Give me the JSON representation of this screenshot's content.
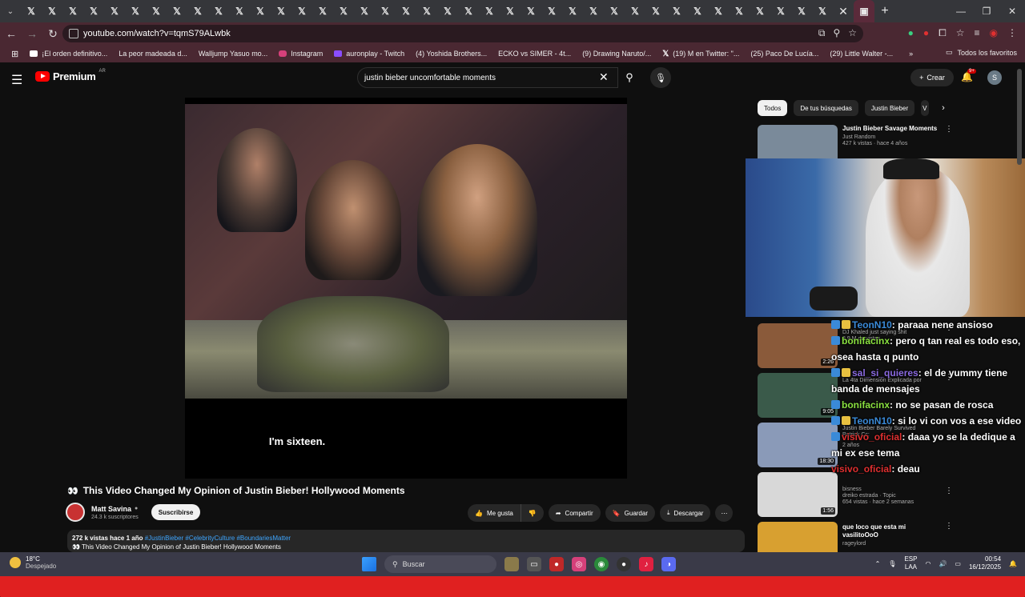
{
  "browser": {
    "url": "youtube.com/watch?v=tqmS79ALwbk",
    "bookmarks": [
      {
        "label": "¡El orden definitivo...",
        "icon": "el"
      },
      {
        "label": "La peor madeada d...",
        "icon": "yt"
      },
      {
        "label": "Walljump Yasuo mo...",
        "icon": "yt"
      },
      {
        "label": "Instagram",
        "icon": "ig"
      },
      {
        "label": "auronplay - Twitch",
        "icon": "tw"
      },
      {
        "label": "(4) Yoshida Brothers...",
        "icon": "yt"
      },
      {
        "label": "ECKO vs SIMER - 4t...",
        "icon": "yt"
      },
      {
        "label": "(9) Drawing Naruto/...",
        "icon": "yt"
      },
      {
        "label": "(19) M en Twitter: \"...",
        "icon": "x"
      },
      {
        "label": "(25) Paco De Lucía...",
        "icon": "yt"
      },
      {
        "label": "(29) Little Walter -...",
        "icon": "yt"
      }
    ],
    "bookmarks_folder": "Todos los favoritos"
  },
  "youtube": {
    "logo_text": "Premium",
    "region": "AR",
    "search_query": "justin bieber uncomfortable moments",
    "create_label": "Crear",
    "notif_count": "9+",
    "avatar_letter": "S",
    "video": {
      "subtitle": "I'm sixteen.",
      "title": "This Video Changed My Opinion of Justin Bieber! Hollywood Moments",
      "title_emoji": "👀",
      "channel": "Matt Savina",
      "subscribers": "24.3 k suscriptores",
      "subscribe_label": "Suscribirse",
      "like_label": "Me gusta",
      "share_label": "Compartir",
      "save_label": "Guardar",
      "download_label": "Descargar",
      "stats": "272 k vistas  hace 1 año",
      "tags": "#JustinBieber #CelebrityCulture #BoundariesMatter",
      "desc_line2": "👀 This Video Changed My Opinion of Justin Bieber! Hollywood Moments"
    },
    "chips": [
      {
        "label": "Todos",
        "active": true
      },
      {
        "label": "De tus búsquedas",
        "active": false
      },
      {
        "label": "Justin Bieber",
        "active": false
      },
      {
        "label": "V",
        "active": false
      }
    ],
    "recommendations": [
      {
        "title": "Justin Bieber Savage Moments",
        "channel": "Just Random",
        "views": "427 k vistas · hace 4 años",
        "duration": "",
        "thumb_color": "#7a8a9a"
      },
      {
        "title": "DJ Khaled just saying shit",
        "channel": "",
        "views": "3.9 M de vistas",
        "duration": "2:26",
        "thumb_color": "#8a5a3a"
      },
      {
        "title": "La 4ta Dimensión Explicada por",
        "channel": "",
        "views": "",
        "duration": "9:05",
        "thumb_color": "#3a5a4a"
      },
      {
        "title": "Justin Bieber Barely Survived",
        "channel": "Patrick Cc:",
        "views": "2 años",
        "duration": "18:30",
        "thumb_color": "#8a9ab8"
      },
      {
        "title": "bisness",
        "channel": "dreiko estrada · Topic",
        "views": "654 vistas · hace 2 semanas",
        "duration": "1:56",
        "thumb_color": "#d8d8d8"
      },
      {
        "title": "que loco que esta mi vasilitoOoO",
        "channel": "rageylord",
        "views": "",
        "duration": "",
        "thumb_color": "#d8a030"
      }
    ]
  },
  "stream_chat": [
    {
      "user": "TeonN10",
      "user_color": "#3a8ad8",
      "text": ": paraaa nene ansioso"
    },
    {
      "user": "bonifacinx",
      "user_color": "#8ae040",
      "text": ": pero q tan real es todo eso, osea hasta q punto"
    },
    {
      "user": "sal_si_quieres",
      "user_color": "#8a6ae0",
      "text": ": el de yummy tiene banda de mensajes"
    },
    {
      "user": "bonifacinx",
      "user_color": "#8ae040",
      "text": ": no se pasan de rosca"
    },
    {
      "user": "TeonN10",
      "user_color": "#3a8ad8",
      "text": ": si lo vi con vos a ese video"
    },
    {
      "user": "visivo_oficial",
      "user_color": "#e03030",
      "text": ": daaa yo se la dedique a mi ex ese tema"
    },
    {
      "user": "visivo_oficial",
      "user_color": "#e03030",
      "text": ": deau"
    }
  ],
  "taskbar": {
    "temperature": "18°C",
    "weather": "Despejado",
    "search_label": "Buscar",
    "lang1": "ESP",
    "lang2": "LAA",
    "time": "00:54",
    "date": "16/12/2025"
  }
}
